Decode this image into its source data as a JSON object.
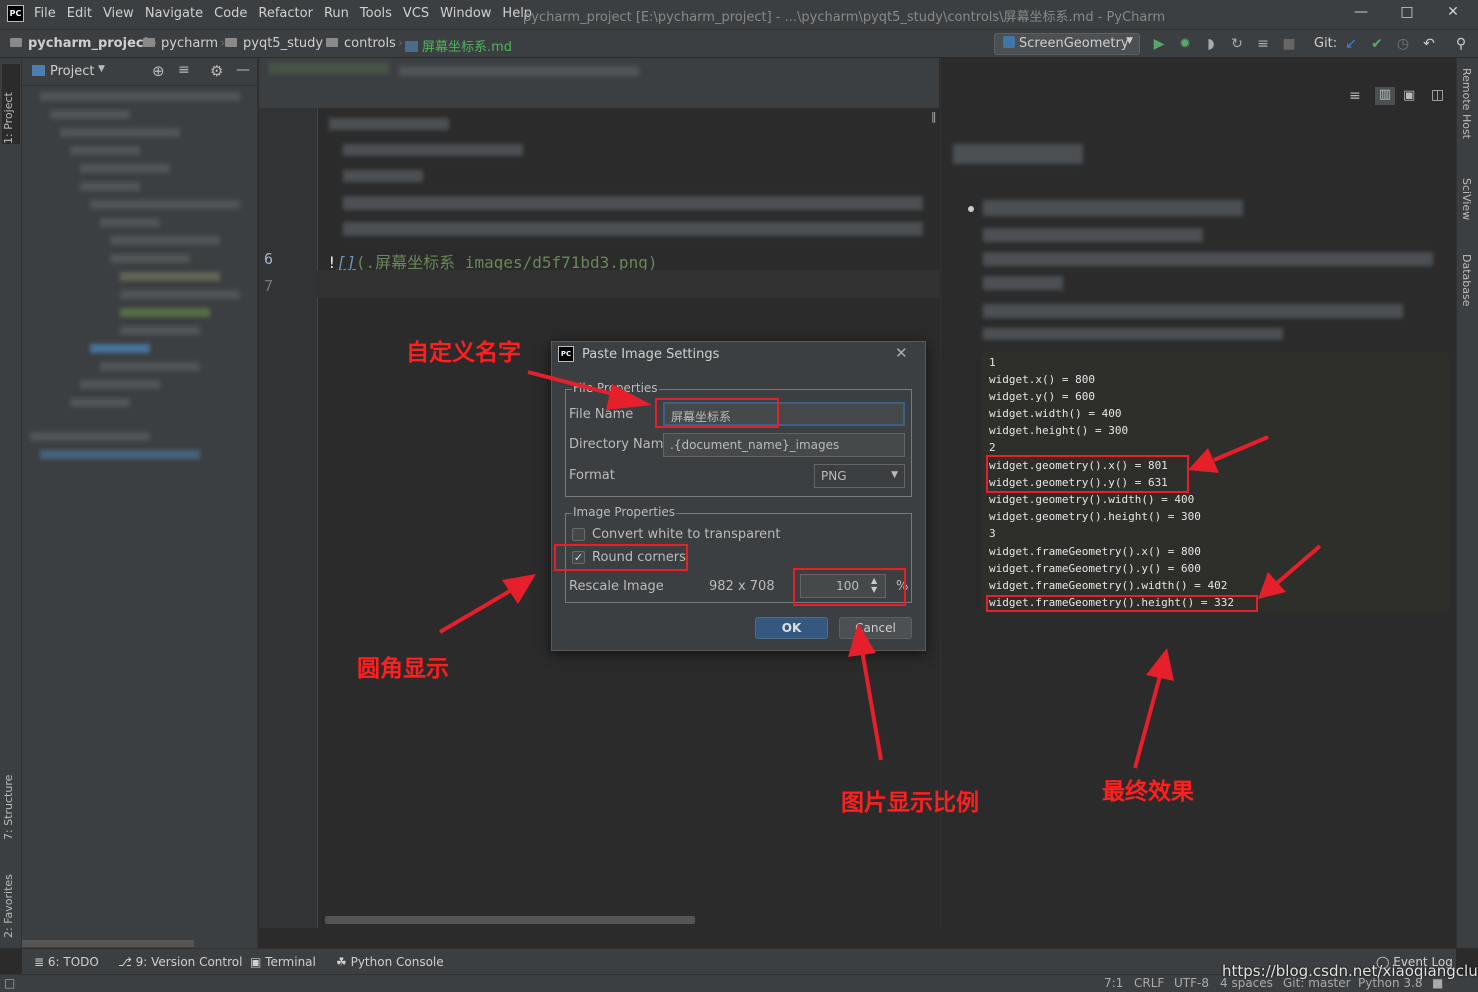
{
  "app": {
    "logo": "PC",
    "menu": [
      "File",
      "Edit",
      "View",
      "Navigate",
      "Code",
      "Refactor",
      "Run",
      "Tools",
      "VCS",
      "Window",
      "Help"
    ],
    "window_title": "pycharm_project [E:\\pycharm_project] - ...\\pycharm\\pyqt5_study\\controls\\屏幕坐标系.md - PyCharm"
  },
  "breadcrumb": [
    "pycharm_project",
    "pycharm",
    "pyqt5_study",
    "controls",
    "屏幕坐标系.md"
  ],
  "toolbar": {
    "run_config": "ScreenGeometry",
    "git_label": "Git:"
  },
  "project_panel": {
    "title": "Project"
  },
  "left_tabs": {
    "project": "1: Project",
    "structure": "7: Structure",
    "favorites": "2: Favorites"
  },
  "right_tabs": {
    "remote_host": "Remote Host",
    "sciview": "SciView",
    "database": "Database"
  },
  "editor": {
    "lines": [
      {
        "num": "6",
        "text": "![](.屏幕坐标系_images/d5f71bd3.png)"
      },
      {
        "num": "7",
        "text": ""
      }
    ],
    "code_prefix": "!",
    "code_brackets": "[]",
    "code_link": "(.屏幕坐标系_images/d5f71bd3.png)"
  },
  "preview": {
    "lines": [
      "1",
      "widget.x() = 800",
      "widget.y() = 600",
      "widget.width() = 400",
      "widget.height() = 300",
      "2",
      "widget.geometry().x() = 801",
      "widget.geometry().y() = 631",
      "widget.geometry().width() = 400",
      "widget.geometry().height() = 300",
      "3",
      "widget.frameGeometry().x() = 800",
      "widget.frameGeometry().y() = 600",
      "widget.frameGeometry().width() = 402",
      "widget.frameGeometry().height() = 332"
    ]
  },
  "dialog": {
    "title": "Paste Image Settings",
    "file_props_title": "File Properties",
    "file_name_label": "File Name",
    "file_name_value": "屏幕坐标系",
    "dir_label": "Directory Name",
    "dir_value": ".{document_name}_images",
    "format_label": "Format",
    "format_value": "PNG",
    "image_props_title": "Image Properties",
    "convert_label": "Convert white to transparent",
    "convert_checked": false,
    "round_label": "Round corners",
    "round_checked": true,
    "rescale_label": "Rescale Image",
    "dimensions": "982 x 708",
    "scale_value": "100",
    "percent": "%",
    "ok": "OK",
    "cancel": "Cancel"
  },
  "annotations": {
    "custom_name": "自定义名字",
    "round_display": "圆角显示",
    "image_ratio": "图片显示比例",
    "final_effect": "最终效果"
  },
  "bottom_tabs": [
    "6: TODO",
    "9: Version Control",
    "Terminal",
    "Python Console",
    "Event Log"
  ],
  "status": {
    "position": "7:1",
    "line_sep": "CRLF",
    "encoding": "UTF-8",
    "indent": "4 spaces",
    "git": "Git: master",
    "python": "Python 3.8"
  },
  "watermark": "https://blog.csdn.net/xiaoqiangclub",
  "colors": {
    "annotation_red": "#e5202a",
    "bg": "#2b2b2b",
    "panel": "#3c3f41",
    "ok_button": "#365880"
  }
}
